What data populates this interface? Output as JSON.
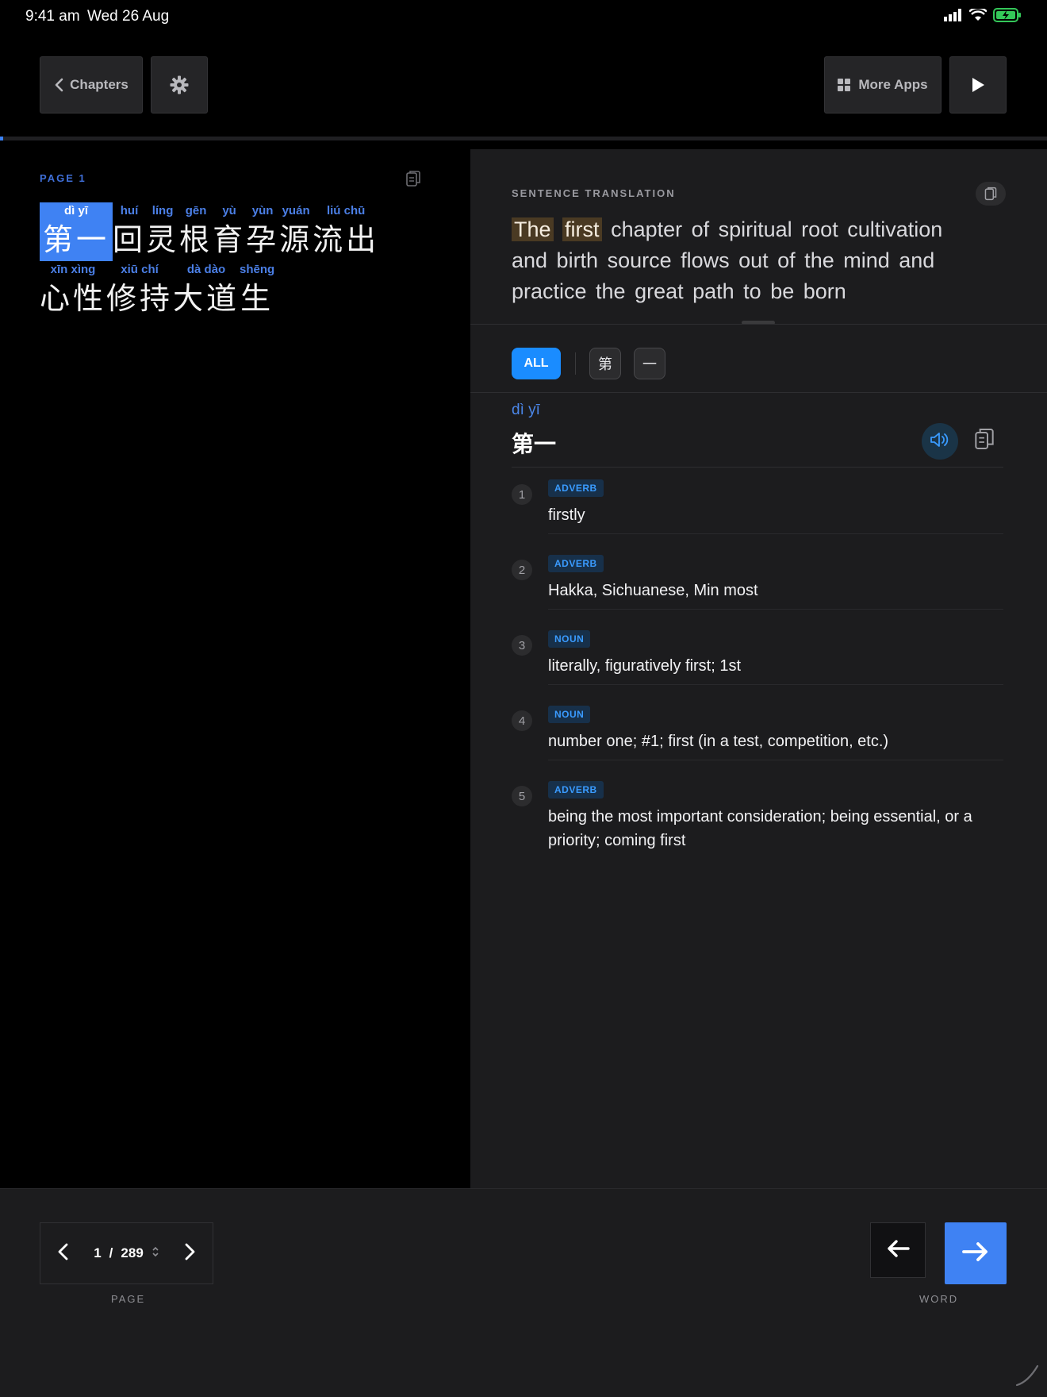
{
  "status_bar": {
    "time": "9:41 am",
    "date": "Wed 26 Aug"
  },
  "toolbar": {
    "chapters_label": "Chapters",
    "more_apps_label": "More Apps"
  },
  "reading_progress": 0.003,
  "reader": {
    "page_label": "PAGE 1",
    "lines": [
      [
        {
          "pinyin": "dì yī",
          "hanzi": "第一",
          "active": true
        },
        {
          "pinyin": "huí",
          "hanzi": "回"
        },
        {
          "pinyin": "líng",
          "hanzi": "灵"
        },
        {
          "pinyin": "gēn",
          "hanzi": "根"
        },
        {
          "pinyin": "yù",
          "hanzi": "育"
        },
        {
          "pinyin": "yùn",
          "hanzi": "孕"
        },
        {
          "pinyin": "yuán",
          "hanzi": "源"
        },
        {
          "pinyin": "liú chū",
          "hanzi": "流出"
        }
      ],
      [
        {
          "pinyin": "xīn xìng",
          "hanzi": "心性"
        },
        {
          "pinyin": "xiū chí",
          "hanzi": "修持"
        },
        {
          "pinyin": "dà dào",
          "hanzi": "大道"
        },
        {
          "pinyin": "shēng",
          "hanzi": "生"
        }
      ]
    ]
  },
  "translation": {
    "label": "SENTENCE TRANSLATION",
    "highlight_1": "The",
    "highlight_2": "first",
    "rest": "chapter of spiritual root cultivation and birth source flows out of the mind and practice the great path to be born"
  },
  "filters": {
    "all_label": "ALL",
    "chars": [
      "第",
      "一"
    ]
  },
  "entry": {
    "pinyin": "dì yī",
    "hanzi": "第一",
    "definitions": [
      {
        "num": "1",
        "pos": "ADVERB",
        "gloss": "firstly"
      },
      {
        "num": "2",
        "pos": "ADVERB",
        "gloss": "Hakka, Sichuanese, Min most"
      },
      {
        "num": "3",
        "pos": "NOUN",
        "gloss": "literally, figuratively first; 1st"
      },
      {
        "num": "4",
        "pos": "NOUN",
        "gloss": "number one; #1; first (in a test, competition, etc.)"
      },
      {
        "num": "5",
        "pos": "ADVERB",
        "gloss": "being the most important consideration; being essential, or a priority; coming first"
      }
    ]
  },
  "pager": {
    "current": "1",
    "separator": "/",
    "total": "289",
    "label": "PAGE"
  },
  "word_nav": {
    "label": "WORD"
  },
  "colors": {
    "accent": "#3f82f3",
    "chip_active": "#1a8cff",
    "pinyin": "#4b7fe6",
    "pos_tag": "#3a9bff",
    "highlight": "#4a3a23"
  }
}
